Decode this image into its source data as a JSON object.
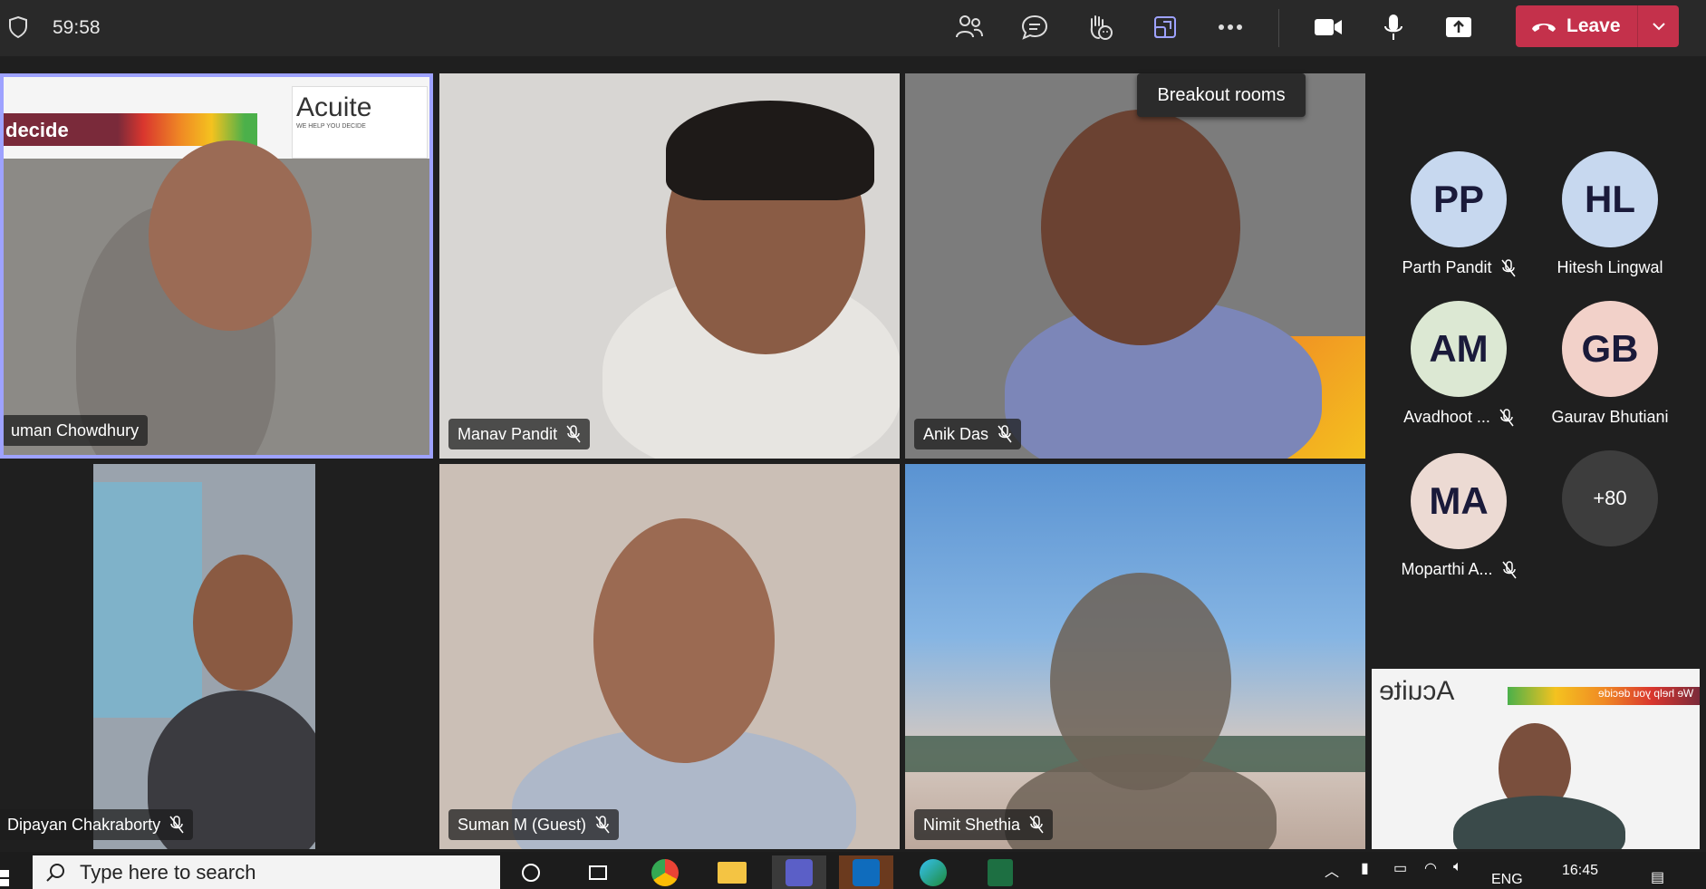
{
  "meeting": {
    "timer": "59:58",
    "tooltip": "Breakout rooms",
    "leave_label": "Leave"
  },
  "toolbar": {
    "icons": [
      "people-icon",
      "chat-icon",
      "raise-hand-icon",
      "breakout-rooms-icon",
      "more-icon",
      "camera-icon",
      "mic-icon",
      "share-icon"
    ]
  },
  "tiles": [
    {
      "name": "uman Chowdhury",
      "muted": false,
      "active": true
    },
    {
      "name": "Manav Pandit",
      "muted": true
    },
    {
      "name": "Anik Das",
      "muted": true
    },
    {
      "name": "Dipayan Chakraborty",
      "muted": true
    },
    {
      "name": "Suman M (Guest)",
      "muted": true
    },
    {
      "name": "Nimit Shethia",
      "muted": true
    }
  ],
  "slide_text": {
    "decide": "decide",
    "acuite": "Acuite",
    "acuite_tagline": "WE HELP YOU DECIDE",
    "mirror_brand": "Acuite",
    "mirror_tagline": "We help you decide"
  },
  "roster": [
    {
      "initials": "PP",
      "name": "Parth Pandit",
      "muted": true,
      "color": "#c7d8ef"
    },
    {
      "initials": "HL",
      "name": "Hitesh Lingwal",
      "muted": false,
      "color": "#c7d8ef"
    },
    {
      "initials": "AM",
      "name": "Avadhoot ...",
      "muted": true,
      "color": "#dce8d3"
    },
    {
      "initials": "GB",
      "name": "Gaurav Bhutiani",
      "muted": false,
      "color": "#f2d1c9"
    },
    {
      "initials": "MA",
      "name": "Moparthi A...",
      "muted": true,
      "color": "#ecdad3"
    }
  ],
  "overflow": "+80",
  "taskbar": {
    "search_placeholder": "Type here to search",
    "clock": "16:45",
    "lang": "ENG"
  },
  "colors": {
    "leave": "#c4314b",
    "active_border": "#9ea2ff",
    "topbar": "#292929"
  }
}
